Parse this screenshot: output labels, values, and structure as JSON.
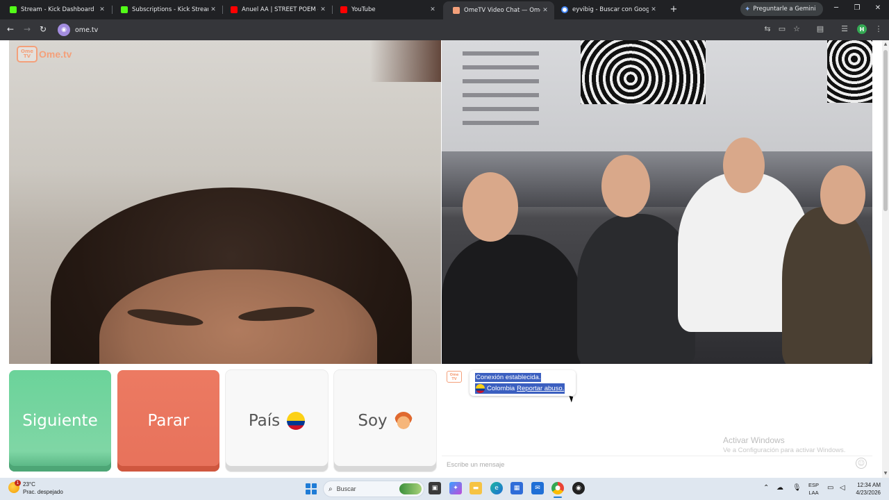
{
  "browser": {
    "tabs": [
      {
        "label": "Stream - Kick Dashboard",
        "icon": "kick-icon",
        "color": "#53fc18"
      },
      {
        "label": "Subscriptions - Kick Streaming",
        "icon": "kick-icon",
        "color": "#53fc18"
      },
      {
        "label": "Anuel AA | STREET POEM - You",
        "icon": "youtube-icon",
        "color": "#ff0000"
      },
      {
        "label": "YouTube",
        "icon": "youtube-icon",
        "color": "#ff0000"
      },
      {
        "label": "OmeTV Video Chat — Ome",
        "icon": "ometv-icon",
        "color": "#f4a07a",
        "active": true
      },
      {
        "label": "eyvibig - Buscar con Google",
        "icon": "google-icon",
        "color": "#4285f4"
      }
    ],
    "new_tab": "+",
    "gemini_label": "Preguntarle a Gemini",
    "url": "ome.tv",
    "profile_initial": "H"
  },
  "page": {
    "logo_badge": "Ome TV",
    "logo_text": "Ome.tv",
    "chat": {
      "badge": "Ome TV",
      "status": "Conexión establecida.",
      "country": "Colombia",
      "report_link": "Reportar abuso.",
      "input_placeholder": "Escribe un mensaje"
    },
    "buttons": {
      "next": "Siguiente",
      "stop": "Parar",
      "country": "País",
      "gender": "Soy"
    },
    "watermark": {
      "title": "Activar Windows",
      "subtitle": "Ve a Configuración para activar Windows."
    }
  },
  "taskbar": {
    "temperature": "23°C",
    "condition": "Prac. despejado",
    "weather_badge": "1",
    "search_label": "Buscar",
    "lang_line1": "ESP",
    "lang_line2": "LAA",
    "time": "12:34 AM",
    "date": "4/23/2026"
  },
  "colors": {
    "next_button": "#6bd39a",
    "stop_button": "#e8735c",
    "selection_highlight": "#3b5fc0",
    "ometv_accent": "#f4a07a"
  }
}
